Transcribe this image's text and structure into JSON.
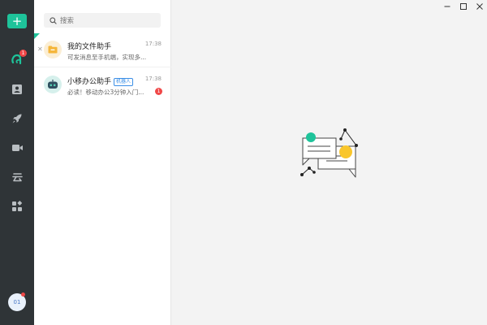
{
  "rail": {
    "add_label": "+",
    "chat_badge": "1",
    "avatar_label": "01",
    "items": [
      {
        "icon": "chat-icon"
      },
      {
        "icon": "contacts-icon"
      },
      {
        "icon": "rocket-icon"
      },
      {
        "icon": "video-icon"
      },
      {
        "icon": "cloud-icon"
      },
      {
        "icon": "apps-icon"
      }
    ],
    "accent": "#1ec39a"
  },
  "search": {
    "placeholder": "搜索"
  },
  "conversations": [
    {
      "title": "我的文件助手",
      "time": "17:38",
      "preview": "可发消息至手机端，实现多...",
      "icon": "folder-icon"
    },
    {
      "title": "小移办公助手",
      "tag": "机器人",
      "time": "17:38",
      "preview": "必读！移动办公3分钟入门...",
      "unread": "1",
      "icon": "robot-icon"
    }
  ],
  "window_controls": {
    "minimize_icon": "minimize-icon",
    "maximize_icon": "maximize-icon",
    "close_icon": "close-icon"
  }
}
